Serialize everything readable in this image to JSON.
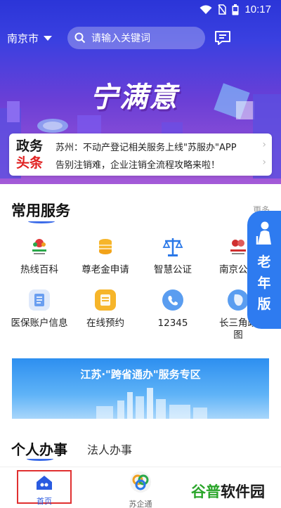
{
  "status": {
    "time": "10:17"
  },
  "header": {
    "city": "南京市",
    "search_placeholder": "请输入关键词",
    "banner_title": "宁满意"
  },
  "news": {
    "badge_line1": "政务",
    "badge_line2": "头条",
    "items": [
      "苏州：不动产登记相关服务上线\"苏服办\"APP",
      "告别注销难，企业注销全流程攻略来啦！"
    ]
  },
  "services": {
    "title": "常用服务",
    "more": "更多",
    "items": [
      {
        "label": "热线百科",
        "icon": "hotline-icon"
      },
      {
        "label": "尊老金申请",
        "icon": "coins-icon"
      },
      {
        "label": "智慧公证",
        "icon": "scales-icon"
      },
      {
        "label": "南京公积",
        "icon": "housing-fund-icon"
      },
      {
        "label": "医保账户信息",
        "icon": "medical-card-icon"
      },
      {
        "label": "在线预约",
        "icon": "calendar-icon"
      },
      {
        "label": "12345",
        "icon": "phone-icon"
      },
      {
        "label": "长三角政",
        "label2": "图",
        "icon": "map-icon"
      }
    ]
  },
  "elderly": {
    "c1": "老",
    "c2": "年",
    "c3": "版"
  },
  "promo": {
    "text": "江苏·\"跨省通办\"服务专区"
  },
  "personal": {
    "tab_active": "个人办事",
    "tab_other": "法人办事"
  },
  "bottom_nav": {
    "home": "首页",
    "enterprise": "苏企通"
  },
  "watermark": {
    "p1": "谷普",
    "p2": "软件园"
  },
  "colors": {
    "accent": "#2e7bf0",
    "header": "#3a40e0",
    "news_red": "#e02020"
  }
}
